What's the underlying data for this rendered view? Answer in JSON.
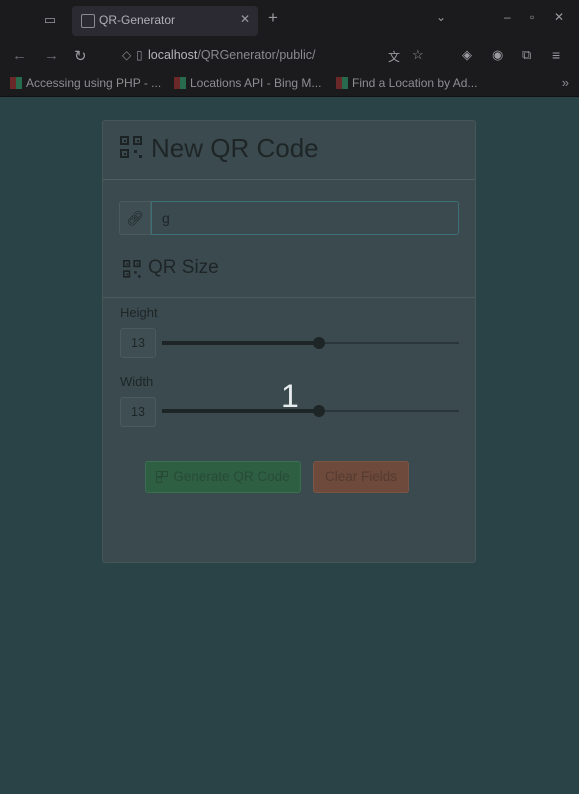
{
  "browser": {
    "tab_title": "QR-Generator",
    "url_host": "localhost",
    "url_path": "/QRGenerator/public/",
    "bookmarks": [
      {
        "label": "Accessing using PHP - ..."
      },
      {
        "label": "Locations API - Bing M..."
      },
      {
        "label": "Find a Location by Ad..."
      }
    ]
  },
  "card": {
    "title": "New QR Code",
    "url_input_value": "g",
    "size_title": "QR Size",
    "height": {
      "label": "Height",
      "value": "13",
      "fraction": 0.53
    },
    "width": {
      "label": "Width",
      "value": "13",
      "fraction": 0.53
    },
    "generate_label": "Generate QR Code",
    "clear_label": "Clear Fields"
  },
  "overlay_number": "1",
  "colors": {
    "page_bg": "#2a4347",
    "generate": "#2e5f43",
    "clear": "#6e4a3c"
  }
}
